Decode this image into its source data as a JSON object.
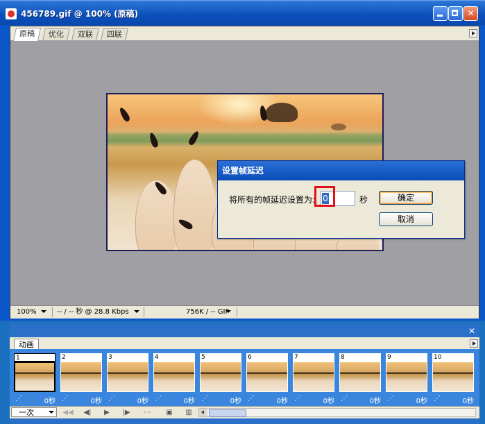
{
  "window": {
    "title": "456789.gif @ 100% (原稿)",
    "tabs": [
      "原稿",
      "优化",
      "双联",
      "四联"
    ],
    "active_tab": "原稿"
  },
  "status": {
    "zoom": "100%",
    "download": "-- / -- 秒 @ 28.8 Kbps",
    "size": "756K / -- GIF"
  },
  "dialog": {
    "title": "设置帧延迟",
    "label": "将所有的帧延迟设置为:",
    "value": "0",
    "unit": "秒",
    "ok_label": "确定",
    "cancel_label": "取消"
  },
  "animation": {
    "tab_label": "动画",
    "loop": "一次",
    "frames": [
      {
        "num": "1",
        "delay": "0秒"
      },
      {
        "num": "2",
        "delay": "0秒"
      },
      {
        "num": "3",
        "delay": "0秒"
      },
      {
        "num": "4",
        "delay": "0秒"
      },
      {
        "num": "5",
        "delay": "0秒"
      },
      {
        "num": "6",
        "delay": "0秒"
      },
      {
        "num": "7",
        "delay": "0秒"
      },
      {
        "num": "8",
        "delay": "0秒"
      },
      {
        "num": "9",
        "delay": "0秒"
      },
      {
        "num": "10",
        "delay": "0秒"
      }
    ]
  },
  "colors": {
    "title_blue": "#0b56c8",
    "highlight_red": "#e0101a",
    "panel_blue": "#3a86de"
  },
  "icons": {
    "close": "close-icon",
    "minimize": "minimize-icon",
    "maximize": "maximize-icon",
    "first_frame": "first-frame-icon",
    "prev_frame": "prev-frame-icon",
    "play": "play-icon",
    "next_frame": "next-frame-icon",
    "tween": "tween-icon",
    "new_frame": "new-frame-icon",
    "delete": "trash-icon"
  }
}
